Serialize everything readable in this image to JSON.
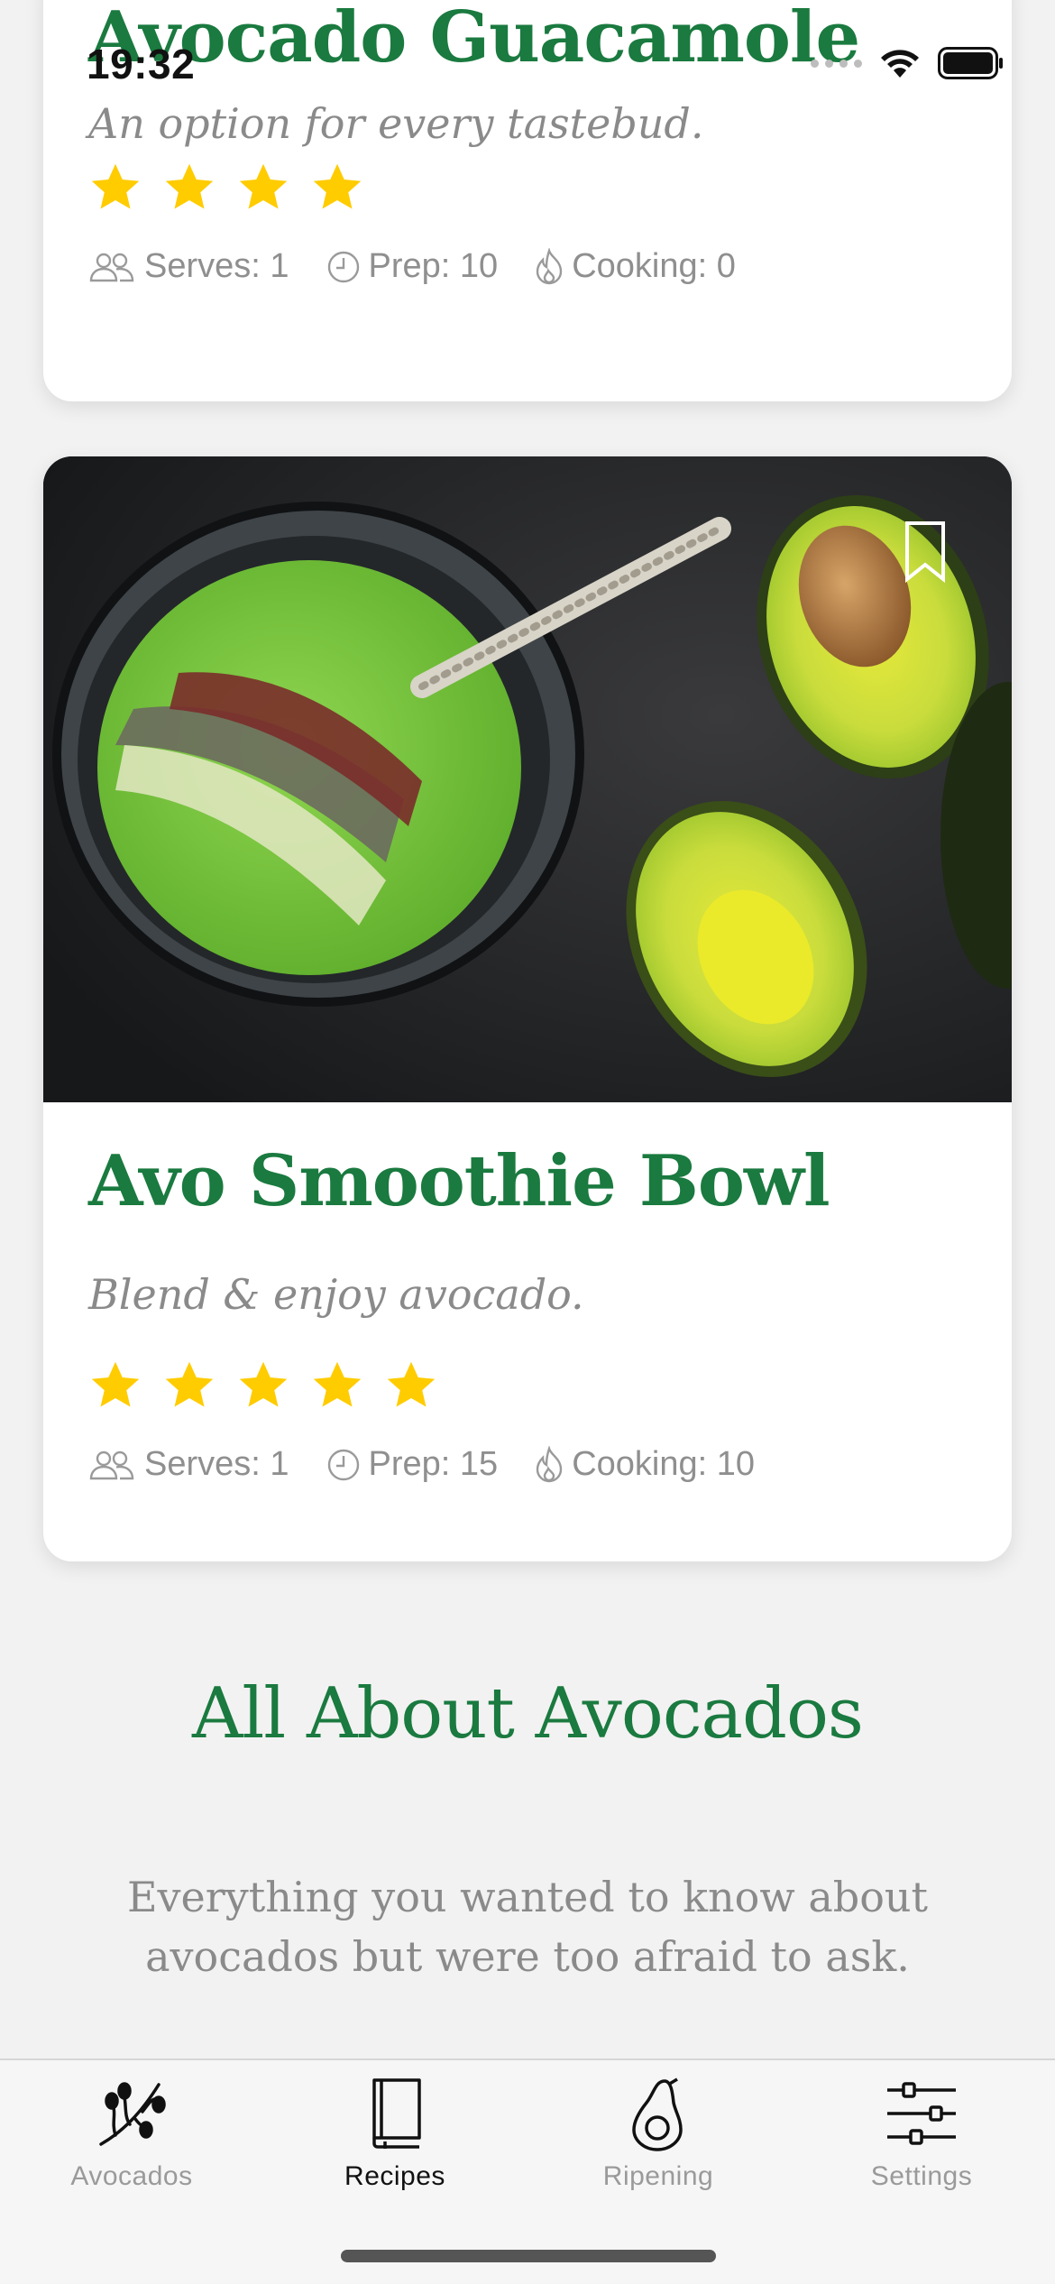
{
  "status_bar": {
    "time": "19:32"
  },
  "recipes": [
    {
      "title": "Avocado Guacamole",
      "subtitle": "An option for every tastebud.",
      "rating": 4,
      "serves_label": "Serves: 1",
      "prep_label": "Prep: 10",
      "cooking_label": "Cooking: 0"
    },
    {
      "title": "Avo Smoothie Bowl",
      "subtitle": "Blend & enjoy avocado.",
      "rating": 5,
      "serves_label": "Serves: 1",
      "prep_label": "Prep: 15",
      "cooking_label": "Cooking: 10"
    }
  ],
  "about": {
    "title": "All About Avocados",
    "body": "Everything you wanted to know about avocados but were too afraid to ask."
  },
  "tab_bar": {
    "active": "Recipes",
    "tabs": [
      {
        "label": "Avocados",
        "icon": "avocado-branch-icon"
      },
      {
        "label": "Recipes",
        "icon": "book-icon"
      },
      {
        "label": "Ripening",
        "icon": "avocado-icon"
      },
      {
        "label": "Settings",
        "icon": "sliders-icon"
      }
    ]
  },
  "colors": {
    "accent_green": "#1a7a3f",
    "star_yellow": "#ffcc00",
    "muted_text": "#8a8a8a"
  }
}
